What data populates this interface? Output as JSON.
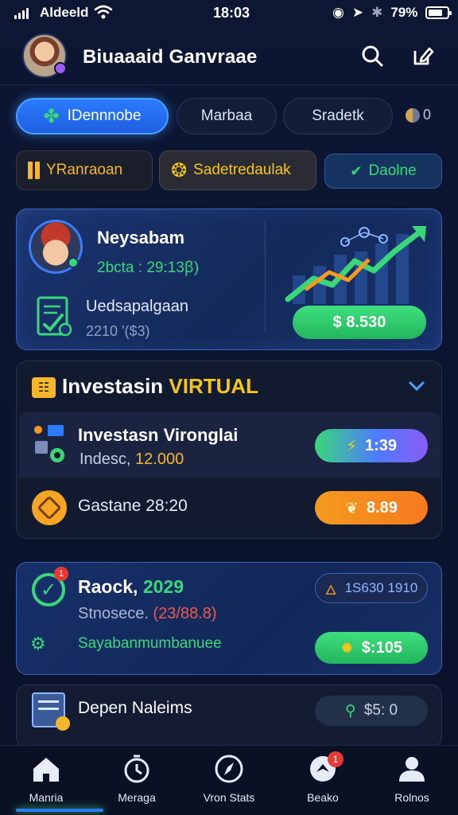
{
  "status_bar": {
    "carrier": "Aldeeld",
    "time": "18:03",
    "battery": "79%",
    "battery_level": 0.79
  },
  "header": {
    "title": "Biuaaaid Ganvraae"
  },
  "tabs": [
    {
      "label": "IDennnobe",
      "active": true
    },
    {
      "label": "Marbaa",
      "active": false
    },
    {
      "label": "Sradetk",
      "active": false
    }
  ],
  "tabs_extra": {
    "count": "0"
  },
  "filter_chips": [
    {
      "label": "YRanraoan",
      "color": "#f5b62a"
    },
    {
      "label": "Sadetredaulak",
      "color": "#f5c518"
    },
    {
      "label": "Daolne",
      "color": "#3ad77a"
    }
  ],
  "profile_card": {
    "name": "Neysabam",
    "detail": "2bcta : 29:13ꞵ)",
    "doc_title": "Uedsapalgaan",
    "doc_sub": "2210 '($3)",
    "amount_button": "$ 8.530"
  },
  "invest_section": {
    "title_prefix": "Investasin",
    "title_highlight": "VIRTUAL",
    "items": [
      {
        "title": "Investasn Vironglаi",
        "sub_prefix": "Indesc,",
        "sub_value": "12.000",
        "button": "1:39"
      },
      {
        "title": "Gastane 28:20",
        "button": "8.89"
      }
    ]
  },
  "report_card": {
    "title_prefix": "Raock,",
    "title_year": "2029",
    "sub_prefix": "Stnosece.",
    "sub_value": "(23/88.8)",
    "link": "Sayabanmumbanuee",
    "badge_count": "1",
    "chip": "1S630 1910",
    "button": "$:105"
  },
  "deposit_card": {
    "title": "Depen Naleims",
    "button": "$5: 0"
  },
  "bottom_nav": [
    {
      "label": "Manria",
      "icon": "home-icon"
    },
    {
      "label": "Merаga",
      "icon": "clock-icon"
    },
    {
      "label": "Vron Stats",
      "icon": "compass-icon"
    },
    {
      "label": "Beako",
      "icon": "wallet-icon",
      "badge": "1"
    },
    {
      "label": "Rolnos",
      "icon": "user-icon"
    }
  ],
  "colors": {
    "accent": "#2b7bff",
    "green": "#3ad77a",
    "orange": "#f59a1e",
    "yellow": "#f5c518",
    "purple": "#8b5cf6"
  }
}
